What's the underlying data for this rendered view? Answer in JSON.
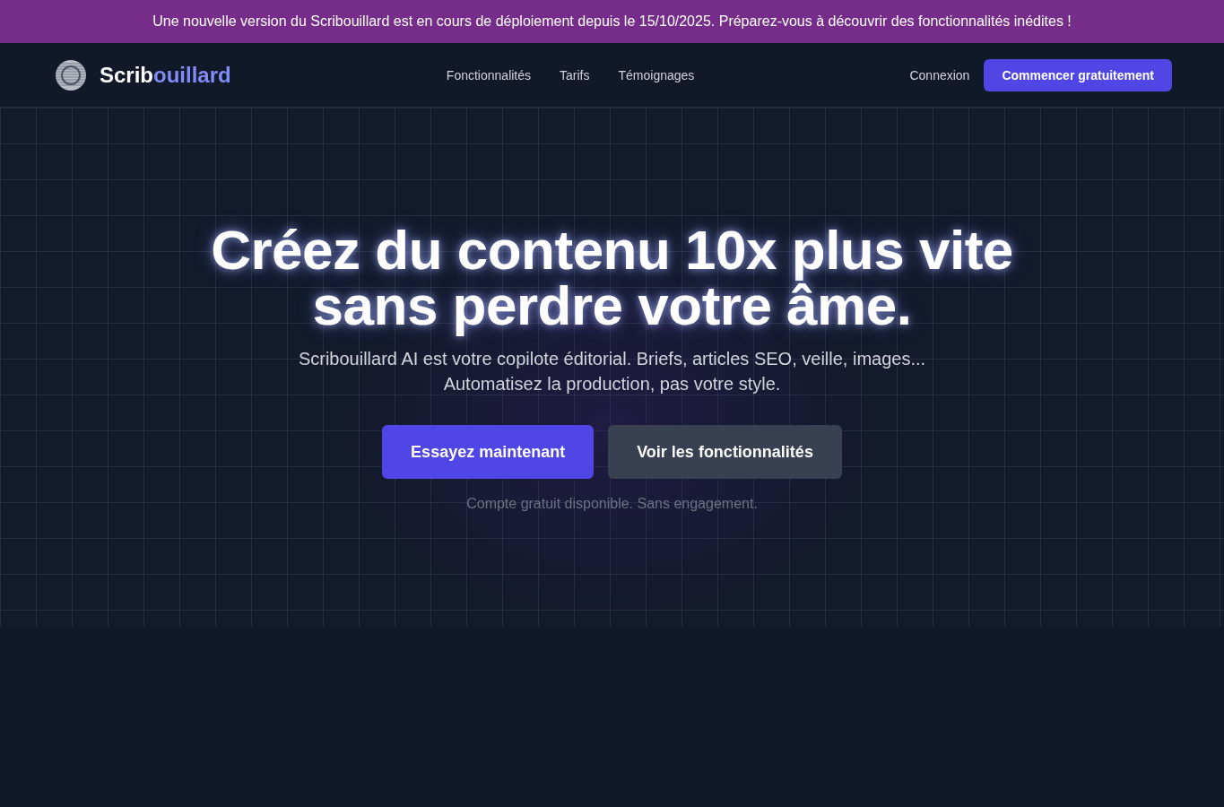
{
  "announcement": {
    "text": "Une nouvelle version du Scribouillard est en cours de déploiement depuis le 15/10/2025. Préparez-vous à découvrir des fonctionnalités inédites !"
  },
  "navbar": {
    "brand": {
      "lead": "Scrib",
      "accent": "ouillard"
    },
    "links": [
      "Fonctionnalités",
      "Tarifs",
      "Témoignages"
    ],
    "login": "Connexion",
    "cta": "Commencer gratuitement"
  },
  "hero": {
    "title_lines": [
      "Créez du contenu 10x plus vite",
      "sans perdre votre âme."
    ],
    "subtitle_lines": [
      "Scribouillard AI est votre copilote éditorial. Briefs, articles SEO, veille, images...",
      "Automatisez la production, pas votre style."
    ],
    "buttons": [
      {
        "label": "Essayez maintenant",
        "kind": "primary"
      },
      {
        "label": "Voir les fonctionnalités",
        "kind": "secondary"
      }
    ],
    "note": "Compte gratuit disponible. Sans engagement."
  }
}
